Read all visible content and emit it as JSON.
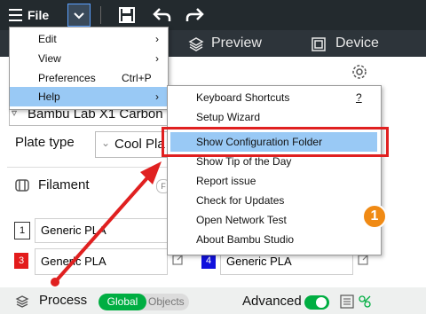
{
  "topbar": {
    "file_label": "File"
  },
  "tabs": {
    "preview": "Preview",
    "device": "Device"
  },
  "printer": {
    "name": "Bambu Lab X1 Carbon"
  },
  "plate": {
    "label": "Plate type",
    "value": "Cool Pla"
  },
  "filament": {
    "label": "Filament",
    "rows": [
      {
        "num": "1",
        "name": "Generic PLA",
        "color": "#ffffff"
      },
      {
        "num": "3",
        "name": "Generic PLA",
        "color": "#e31b1b"
      },
      {
        "num": "4",
        "name": "Generic PLA",
        "color": "#1111dd"
      }
    ]
  },
  "process": {
    "label": "Process",
    "global_label": "Global",
    "objects_label": "Objects",
    "advanced_label": "Advanced"
  },
  "file_menu": {
    "items": [
      {
        "label": "Edit",
        "shortcut": ""
      },
      {
        "label": "View",
        "shortcut": ""
      },
      {
        "label": "Preferences",
        "shortcut": "Ctrl+P"
      },
      {
        "label": "Help",
        "shortcut": ""
      }
    ]
  },
  "help_menu": {
    "items": [
      {
        "label": "Keyboard Shortcuts",
        "shortcut": "?"
      },
      {
        "label": "Setup Wizard",
        "shortcut": ""
      },
      {
        "label": "Show Configuration Folder",
        "shortcut": ""
      },
      {
        "label": "Show Tip of the Day",
        "shortcut": ""
      },
      {
        "label": "Report issue",
        "shortcut": ""
      },
      {
        "label": "Check for Updates",
        "shortcut": ""
      },
      {
        "label": "Open Network Test",
        "shortcut": ""
      },
      {
        "label": "About Bambu Studio",
        "shortcut": ""
      }
    ]
  },
  "annotation": {
    "badge": "1"
  },
  "colors": {
    "highlight": "#99c9f5",
    "annotation_red": "#e02020",
    "badge_orange": "#f08a14",
    "accent_green": "#00ae42"
  }
}
